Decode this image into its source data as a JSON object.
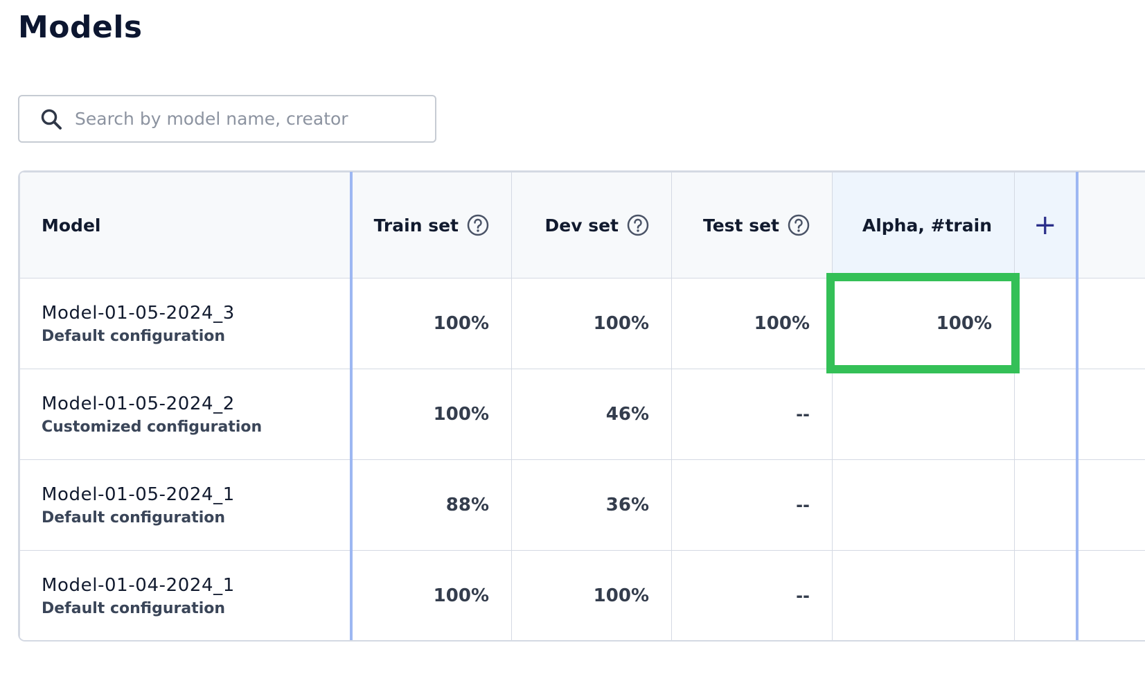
{
  "page": {
    "title": "Models"
  },
  "search": {
    "placeholder": "Search by model name, creator",
    "value": ""
  },
  "table": {
    "columns": {
      "model": "Model",
      "train": "Train set",
      "dev": "Dev set",
      "test": "Test set",
      "alpha": "Alpha, #train",
      "add": "+"
    },
    "rows": [
      {
        "name": "Model-01-05-2024_3",
        "config": "Default configuration",
        "train": "100%",
        "dev": "100%",
        "test": "100%",
        "alpha": "100%"
      },
      {
        "name": "Model-01-05-2024_2",
        "config": "Customized configuration",
        "train": "100%",
        "dev": "46%",
        "test": "--",
        "alpha": ""
      },
      {
        "name": "Model-01-05-2024_1",
        "config": "Default configuration",
        "train": "88%",
        "dev": "36%",
        "test": "--",
        "alpha": ""
      },
      {
        "name": "Model-01-04-2024_1",
        "config": "Default configuration",
        "train": "100%",
        "dev": "100%",
        "test": "--",
        "alpha": ""
      }
    ]
  },
  "colors": {
    "highlight": "#34c057",
    "accent_border": "#9db7f2",
    "add_icon": "#2b2f8a"
  },
  "icons": {
    "search": "search-icon",
    "help": "help-circle-icon",
    "add": "plus-icon"
  }
}
